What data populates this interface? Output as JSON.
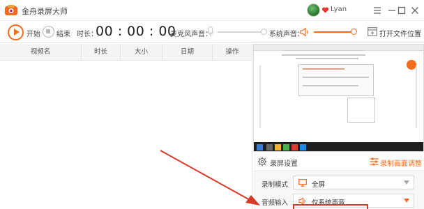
{
  "app": {
    "title": "金舟录屏大师",
    "user_name": "Lyan"
  },
  "toolbar": {
    "start_label": "开始",
    "stop_label": "结束",
    "duration_label": "时长：",
    "timer": "00 : 00 : 00",
    "mic_label": "麦克风声音：",
    "system_sound_label": "系统声音：",
    "system_sound_level_pct": 100,
    "mic_level_pct": 95,
    "open_folder_label": "打开文件位置"
  },
  "file_list": {
    "columns": [
      "视频名",
      "时长",
      "大小",
      "日期",
      "操作"
    ]
  },
  "settings": {
    "title": "录屏设置",
    "adjust_label": "录制画面调整",
    "rows": [
      {
        "label": "录制模式",
        "value": "全屏",
        "icon": "monitor-icon"
      },
      {
        "label": "音频输入",
        "value": "仅系统声音",
        "icon": "speaker-icon"
      }
    ]
  },
  "colors": {
    "accent": "#f56b1d",
    "annotation_red": "#d63a2a"
  }
}
